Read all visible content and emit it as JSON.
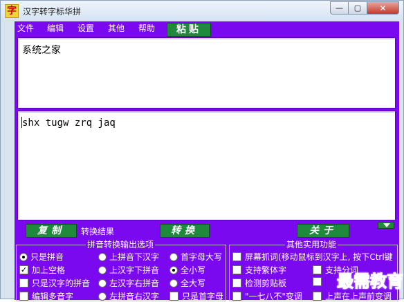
{
  "window": {
    "app_icon_char": "字",
    "title": "汉字转字标华拼",
    "minimize_glyph": "—",
    "maximize_glyph": "▢",
    "close_glyph": "✕"
  },
  "menu": {
    "items": [
      "文件",
      "编辑",
      "设置",
      "其他",
      "帮助"
    ],
    "paste_label": "粘贴"
  },
  "input_text": "系统之家",
  "output_text": "shx tugw zrq jaq",
  "actions": {
    "copy_label": "复制",
    "result_label": "转换结果",
    "convert_label": "转换",
    "close_label": "关于"
  },
  "pinyin_options": {
    "legend": "拼音转换输出选项",
    "items": [
      {
        "label": "只是拼音",
        "type": "radio",
        "checked": true
      },
      {
        "label": "上拼音下汉字",
        "type": "radio",
        "checked": false
      },
      {
        "label": "首字母大写",
        "type": "radio",
        "checked": false
      },
      {
        "label": "加上空格",
        "type": "check",
        "checked": true
      },
      {
        "label": "上汉字下拼音",
        "type": "radio",
        "checked": false
      },
      {
        "label": "全小写",
        "type": "radio",
        "checked": true
      },
      {
        "label": "只是汉字的拼音",
        "type": "check",
        "checked": false
      },
      {
        "label": "左汉字右拼音",
        "type": "radio",
        "checked": false
      },
      {
        "label": "全大写",
        "type": "radio",
        "checked": false
      },
      {
        "label": "编辑多音字",
        "type": "check",
        "checked": false
      },
      {
        "label": "左拼音右汉字",
        "type": "radio",
        "checked": false
      },
      {
        "label": "只是首字母",
        "type": "check",
        "checked": false
      }
    ]
  },
  "other_functions": {
    "legend": "其他实用功能",
    "items": [
      {
        "label": "屏幕抓词(移动鼠标到汉字上, 按下Ctrl键",
        "type": "check",
        "checked": false
      },
      {
        "label": "支持繁体字",
        "type": "check",
        "checked": false
      },
      {
        "label": "支持分词",
        "type": "check",
        "checked": false
      },
      {
        "label": "检测剪贴板",
        "type": "check",
        "checked": false
      },
      {
        "label": "",
        "type": "check",
        "checked": false
      },
      {
        "label": "\"一七八不\"变调",
        "type": "check",
        "checked": false
      },
      {
        "label": "上声在上声前变调",
        "type": "check",
        "checked": false
      }
    ]
  },
  "watermark": "最需教育",
  "colors": {
    "client_bg": "#7a09f0",
    "button_green": "#1f8a3b",
    "watermark": "#5b57e3"
  }
}
